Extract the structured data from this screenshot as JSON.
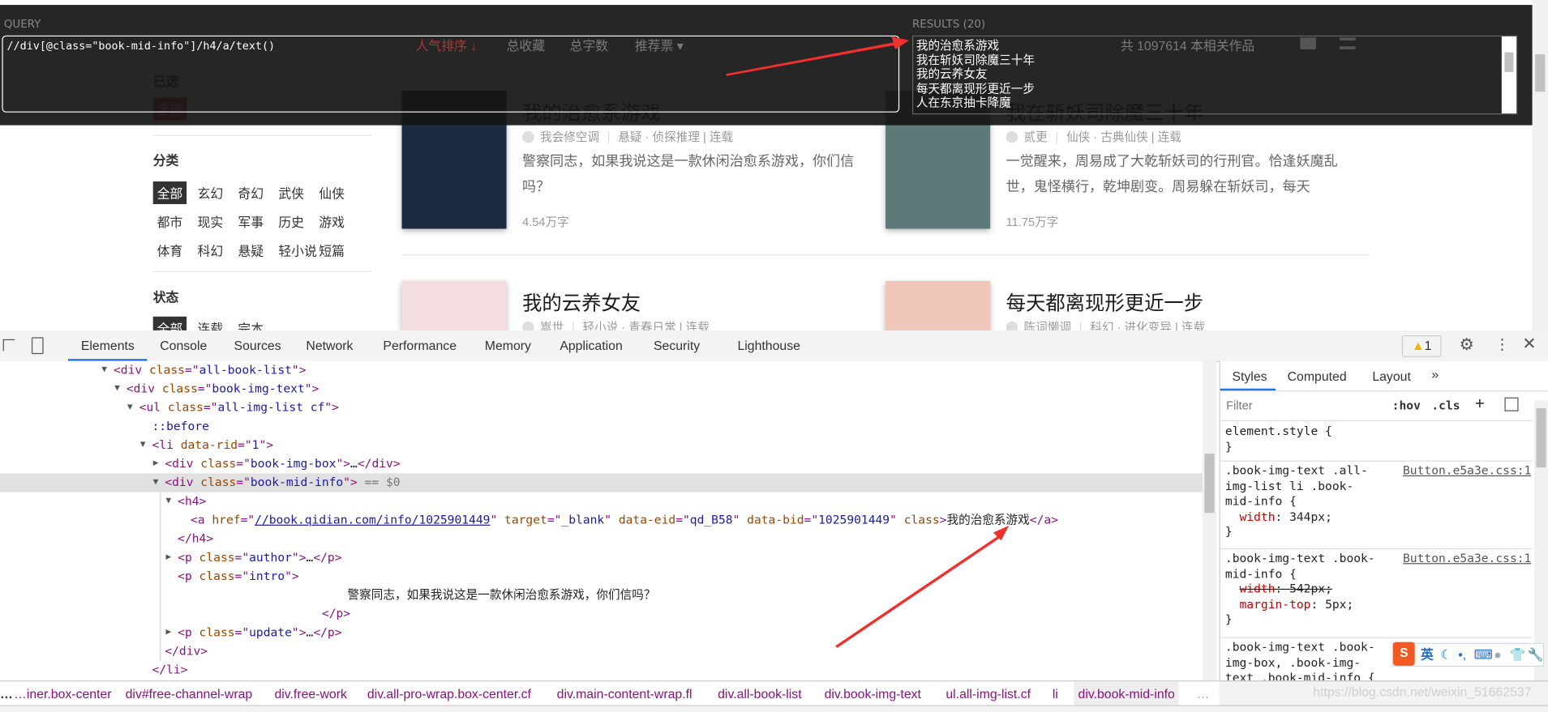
{
  "page": {
    "sort_tabs": [
      "人气排序 ↓",
      "总收藏",
      "总字数",
      "推荐票 ▾"
    ],
    "total_text": "共 1097614 本相关作品",
    "selected_heading": "已选",
    "selected_tag": "全部",
    "category_heading": "分类",
    "categories": [
      "全部",
      "玄幻",
      "奇幻",
      "武侠",
      "仙侠",
      "都市",
      "现实",
      "军事",
      "历史",
      "游戏",
      "体育",
      "科幻",
      "悬疑",
      "轻小说",
      "短篇"
    ],
    "status_heading": "状态",
    "statuses": [
      "全部",
      "连载",
      "完本"
    ],
    "books": [
      {
        "title": "我的治愈系游戏",
        "author": "我会修空调",
        "meta": "悬疑 · 侦探推理 | 连载",
        "intro": "警察同志，如果我说这是一款休闲治愈系游戏，你们信吗？",
        "count": "4.54万字",
        "cover_color": "#1c2a44"
      },
      {
        "title": "我在斩妖司除魔三十年",
        "author": "贰更",
        "meta": "仙侠 · 古典仙侠 | 连载",
        "intro": "一觉醒来，周易成了大乾斩妖司的行刑官。恰逢妖魔乱世，鬼怪横行，乾坤剧变。周易躲在斩妖司，每天",
        "count": "11.75万字",
        "cover_color": "#5e7a78"
      },
      {
        "title": "我的云养女友",
        "author": "嵩世",
        "meta": "轻小说 · 青春日常 | 连载",
        "intro": "",
        "count": "",
        "cover_color": "#f3dde0"
      },
      {
        "title": "每天都离现形更近一步",
        "author": "陈词懒调",
        "meta": "科幻 · 进化变异 | 连载",
        "intro": "",
        "count": "",
        "cover_color": "#efc6b8"
      }
    ]
  },
  "xpath_helper": {
    "query_label": "QUERY",
    "query": "//div[@class=\"book-mid-info\"]/h4/a/text()",
    "results_label": "RESULTS (20)",
    "results": [
      "我的治愈系游戏",
      "我在斩妖司除魔三十年",
      "我的云养女友",
      "每天都离现形更近一步",
      "人在东京抽卡降魔"
    ]
  },
  "devtools": {
    "tabs": [
      "Elements",
      "Console",
      "Sources",
      "Network",
      "Performance",
      "Memory",
      "Application",
      "Security",
      "Lighthouse"
    ],
    "active_tab": "Elements",
    "warning_count": "1",
    "dom_lines": [
      {
        "depth": 0,
        "tri": "▼",
        "segs": [
          [
            "tg",
            "<div "
          ],
          [
            "an",
            "class"
          ],
          [
            "tg",
            "=\""
          ],
          [
            "av",
            "all-book-list"
          ],
          [
            "tg",
            "\">"
          ]
        ]
      },
      {
        "depth": 1,
        "tri": "▼",
        "segs": [
          [
            "tg",
            "<div "
          ],
          [
            "an",
            "class"
          ],
          [
            "tg",
            "=\""
          ],
          [
            "av",
            "book-img-text"
          ],
          [
            "tg",
            "\">"
          ]
        ]
      },
      {
        "depth": 2,
        "tri": "▼",
        "segs": [
          [
            "tg",
            "<ul "
          ],
          [
            "an",
            "class"
          ],
          [
            "tg",
            "=\""
          ],
          [
            "av",
            "all-img-list cf"
          ],
          [
            "tg",
            "\">"
          ]
        ]
      },
      {
        "depth": 3,
        "tri": "",
        "segs": [
          [
            "ps",
            "::before"
          ]
        ]
      },
      {
        "depth": 3,
        "tri": "▼",
        "segs": [
          [
            "tg",
            "<li "
          ],
          [
            "an",
            "data-rid"
          ],
          [
            "tg",
            "=\""
          ],
          [
            "av",
            "1"
          ],
          [
            "tg",
            "\">"
          ]
        ]
      },
      {
        "depth": 4,
        "tri": "▶",
        "segs": [
          [
            "tg",
            "<div "
          ],
          [
            "an",
            "class"
          ],
          [
            "tg",
            "=\""
          ],
          [
            "av",
            "book-img-box"
          ],
          [
            "tg",
            "\">"
          ],
          [
            "tx",
            "…"
          ],
          [
            "tg",
            "</div>"
          ]
        ]
      },
      {
        "depth": 4,
        "tri": "▼",
        "selected": true,
        "segs": [
          [
            "tg",
            "<div "
          ],
          [
            "an",
            "class"
          ],
          [
            "tg",
            "=\""
          ],
          [
            "av",
            "book-mid-info"
          ],
          [
            "tg",
            "\">"
          ],
          [
            "dim",
            " == $0"
          ]
        ]
      },
      {
        "depth": 5,
        "tri": "▼",
        "segs": [
          [
            "tg",
            "<h4>"
          ]
        ]
      },
      {
        "depth": 6,
        "tri": "",
        "segs": [
          [
            "tg",
            "<a "
          ],
          [
            "an",
            "href"
          ],
          [
            "tg",
            "=\""
          ],
          [
            "lk",
            "//book.qidian.com/info/1025901449"
          ],
          [
            "tg",
            "\" "
          ],
          [
            "an",
            "target"
          ],
          [
            "tg",
            "=\""
          ],
          [
            "av",
            "_blank"
          ],
          [
            "tg",
            "\" "
          ],
          [
            "an",
            "data-eid"
          ],
          [
            "tg",
            "=\""
          ],
          [
            "av",
            "qd_B58"
          ],
          [
            "tg",
            "\" "
          ],
          [
            "an",
            "data-bid"
          ],
          [
            "tg",
            "=\""
          ],
          [
            "av",
            "1025901449"
          ],
          [
            "tg",
            "\" "
          ],
          [
            "an",
            "class"
          ],
          [
            "tg",
            ">"
          ],
          [
            "tx",
            "我的治愈系游戏"
          ],
          [
            "tg",
            "</a>"
          ]
        ]
      },
      {
        "depth": 5,
        "tri": "",
        "segs": [
          [
            "tg",
            "</h4>"
          ]
        ]
      },
      {
        "depth": 5,
        "tri": "▶",
        "segs": [
          [
            "tg",
            "<p "
          ],
          [
            "an",
            "class"
          ],
          [
            "tg",
            "=\""
          ],
          [
            "av",
            "author"
          ],
          [
            "tg",
            "\">"
          ],
          [
            "tx",
            "…"
          ],
          [
            "tg",
            "</p>"
          ]
        ]
      },
      {
        "depth": 5,
        "tri": "",
        "segs": [
          [
            "tg",
            "<p "
          ],
          [
            "an",
            "class"
          ],
          [
            "tg",
            "=\""
          ],
          [
            "av",
            "intro"
          ],
          [
            "tg",
            "\">"
          ]
        ]
      },
      {
        "depth": 19,
        "tri": "",
        "segs": [
          [
            "tx",
            "警察同志，如果我说这是一款休闲治愈系游戏，你们信吗？"
          ]
        ]
      },
      {
        "depth": 17,
        "tri": "",
        "segs": [
          [
            "tg",
            "</p>"
          ]
        ]
      },
      {
        "depth": 5,
        "tri": "▶",
        "segs": [
          [
            "tg",
            "<p "
          ],
          [
            "an",
            "class"
          ],
          [
            "tg",
            "=\""
          ],
          [
            "av",
            "update"
          ],
          [
            "tg",
            "\">"
          ],
          [
            "tx",
            "…"
          ],
          [
            "tg",
            "</p>"
          ]
        ]
      },
      {
        "depth": 4,
        "tri": "",
        "segs": [
          [
            "tg",
            "</div>"
          ]
        ]
      },
      {
        "depth": 3,
        "tri": "",
        "segs": [
          [
            "tg",
            "</li>"
          ]
        ]
      }
    ],
    "breadcrumbs": [
      "…iner.box-center",
      "div#free-channel-wrap",
      "div.free-work",
      "div.all-pro-wrap.box-center.cf",
      "div.main-content-wrap.fl",
      "div.all-book-list",
      "div.book-img-text",
      "ul.all-img-list.cf",
      "li",
      "div.book-mid-info"
    ],
    "styles": {
      "tabs": [
        "Styles",
        "Computed",
        "Layout",
        "»"
      ],
      "filter_placeholder": "Filter",
      "hov": ":hov",
      "cls": ".cls",
      "element_style": "element.style {\n}",
      "rule1_selector": ".book-img-text .all-\nimg-list li .book-\nmid-info {",
      "rule1_source": "Button.e5a3e.css:1",
      "rule1_prop": "width",
      "rule1_value": "344px;",
      "rule2_selector": ".book-img-text .book-\nmid-info {",
      "rule2_source": "Button.e5a3e.css:1",
      "rule2_prop1": "width",
      "rule2_value1": "542px;",
      "rule2_prop2": "margin-top",
      "rule2_value2": "5px;",
      "rule3_selector": ".book-img-text .book-\nimg-box, .book-img-\ntext .book-mid-info {"
    }
  },
  "ime_toolbar": {
    "lang": "英"
  },
  "watermark": "https://blog.csdn.net/weixin_51662537",
  "colors": {
    "accent": "#1a73e8",
    "overlay": "#161616",
    "arrow": "#f0302c",
    "qidian_red": "#bf2c24"
  }
}
